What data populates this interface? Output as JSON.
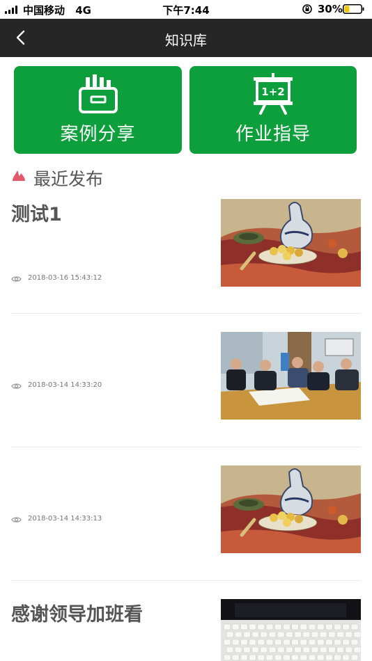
{
  "status_bar": {
    "carrier": "中国移动",
    "network": "4G",
    "time": "下午7:44",
    "battery_percent": "30%",
    "battery_level": 0.3
  },
  "nav": {
    "title": "知识库",
    "back_icon": "chevron-left-icon"
  },
  "tiles": [
    {
      "label": "案例分享",
      "icon": "folder-files-icon",
      "color": "#0d9f3b"
    },
    {
      "label": "作业指导",
      "icon": "easel-board-icon"
    }
  ],
  "recent": {
    "title": "最近发布",
    "icon": "flame-icon",
    "icon_color": "#e05a6a"
  },
  "articles": [
    {
      "title": "测试1",
      "date": "2018-03-16 15:43:12",
      "thumbnail": "still-life-painting"
    },
    {
      "title": "",
      "date": "2018-03-14 14:33:20",
      "thumbnail": "office-meeting-photo"
    },
    {
      "title": "",
      "date": "2018-03-14 14:33:13",
      "thumbnail": "still-life-painting"
    },
    {
      "title": "感谢领导加班看",
      "date": "",
      "thumbnail": "keyboard-photo"
    }
  ]
}
